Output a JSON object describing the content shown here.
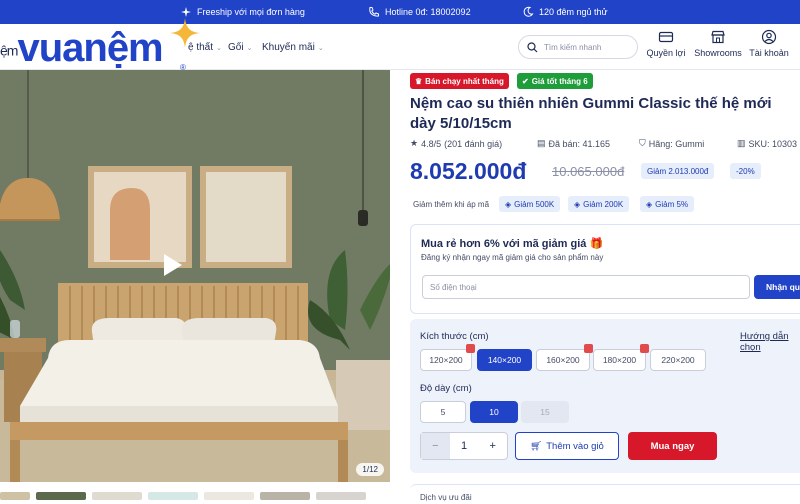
{
  "topbar": {
    "freeship": "Freeship với mọi đơn hàng",
    "hotline": "Hotline 0đ: 18002092",
    "nights": "120 đêm ngủ thử"
  },
  "header": {
    "logo_prefix": "ệm",
    "logo": "vuanệm",
    "logo_reg": "®",
    "nav": [
      {
        "label": "ệ thất",
        "icon": "chevron-down-icon"
      },
      {
        "label": "Gối",
        "icon": "chevron-down-icon"
      },
      {
        "label": "Khuyến mãi",
        "icon": "chevron-down-icon"
      }
    ],
    "search_placeholder": "Tìm kiếm nhanh",
    "icons": [
      {
        "label": "Quyền lợi",
        "icon": "gift-card-icon"
      },
      {
        "label": "Showrooms",
        "icon": "store-icon"
      },
      {
        "label": "Tài khoản",
        "icon": "user-icon"
      }
    ]
  },
  "gallery": {
    "counter": "1/12"
  },
  "product": {
    "badges": [
      {
        "label": "Bán chạy nhất tháng",
        "icon": "crown-icon",
        "color": "#d6182a"
      },
      {
        "label": "Giá tốt tháng 6",
        "icon": "check-badge-icon",
        "color": "#1f9d3a"
      }
    ],
    "title": "Nệm cao su thiên nhiên Gummi Classic thế hệ mới dày 5/10/15cm",
    "rating": "4.8/5",
    "reviews": "(201 đánh giá)",
    "sold": "Đã bán: 41.165",
    "brand": "Hãng: Gummi",
    "sku": "SKU: 10303",
    "price": "8.052.000đ",
    "old_price": "10.065.000đ",
    "discount_amount": "Giảm 2.013.000đ",
    "discount_pct": "-20%",
    "coupon_label": "Giảm thêm khi áp mã",
    "coupons": [
      "Giảm 500K",
      "Giảm 200K",
      "Giảm 5%"
    ]
  },
  "promo": {
    "title": "Mua rẻ hơn 6% với mã giảm giá 🎁",
    "subtitle": "Đăng ký nhận ngay mã giảm giá cho sản phẩm này",
    "phone_placeholder": "Số điện thoại",
    "button": "Nhận quà"
  },
  "options": {
    "size_label": "Kích thước (cm)",
    "size_guide": "Hướng dẫn chọn",
    "sizes": [
      {
        "label": "120×200",
        "gift": true,
        "selected": false
      },
      {
        "label": "140×200",
        "gift": false,
        "selected": true
      },
      {
        "label": "160×200",
        "gift": true,
        "selected": false
      },
      {
        "label": "180×200",
        "gift": true,
        "selected": false
      },
      {
        "label": "220×200",
        "gift": false,
        "selected": false
      }
    ],
    "thickness_label": "Độ dày (cm)",
    "thickness": [
      {
        "label": "5",
        "selected": false,
        "disabled": false
      },
      {
        "label": "10",
        "selected": true,
        "disabled": false
      },
      {
        "label": "15",
        "selected": false,
        "disabled": true
      }
    ],
    "qty_minus": "−",
    "quantity": "1",
    "qty_plus": "+",
    "add_to_cart": "Thêm vào giỏ",
    "buy_now": "Mua ngay"
  },
  "bottom_cut": "Dịch vụ ưu đãi",
  "colors": {
    "brand": "#2143c8",
    "price": "#1e3bb0",
    "buy": "#d6182a",
    "best_seller": "#d6182a",
    "good_price": "#1f9d3a"
  }
}
